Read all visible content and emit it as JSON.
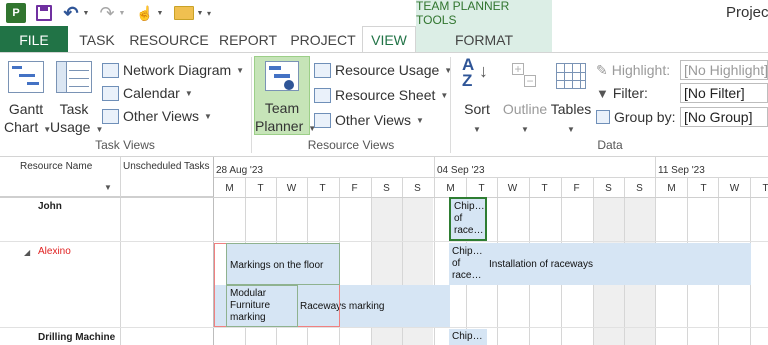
{
  "quick_access": {
    "app_icon_label": "P",
    "more_glyph": "▾"
  },
  "title_bar": {
    "tools_title": "TEAM PLANNER TOOLS",
    "app_title": "Project"
  },
  "tabs": [
    "FILE",
    "TASK",
    "RESOURCE",
    "REPORT",
    "PROJECT",
    "VIEW",
    "FORMAT"
  ],
  "active_tab": "VIEW",
  "ribbon": {
    "task_views": {
      "label": "Task Views",
      "gantt_line1": "Gantt",
      "gantt_line2": "Chart",
      "usage_line1": "Task",
      "usage_line2": "Usage",
      "network_diagram": "Network Diagram",
      "calendar": "Calendar",
      "other_views": "Other Views"
    },
    "resource_views": {
      "label": "Resource Views",
      "team_line1": "Team",
      "team_line2": "Planner",
      "resource_usage": "Resource Usage",
      "resource_sheet": "Resource Sheet",
      "other_views": "Other Views"
    },
    "data": {
      "label": "Data",
      "sort": "Sort",
      "outline": "Outline",
      "tables": "Tables",
      "highlight_label": "Highlight:",
      "highlight_value": "[No Highlight]",
      "filter_label": "Filter:",
      "filter_value": "[No Filter]",
      "group_label": "Group by:",
      "group_value": "[No Group]"
    }
  },
  "grid": {
    "columns": {
      "resource_name": "Resource Name",
      "unscheduled": "Unscheduled Tasks"
    },
    "weeks": [
      "28 Aug '23",
      "04 Sep '23",
      "11 Sep '23"
    ],
    "days": [
      "M",
      "T",
      "W",
      "T",
      "F",
      "S",
      "S",
      "M",
      "T",
      "W",
      "T",
      "F",
      "S",
      "S",
      "M",
      "T",
      "W",
      "T"
    ],
    "resources": [
      "John",
      "Alexino",
      "Drilling Machine"
    ],
    "tasks": {
      "chip_line1": "Chip…",
      "chip_line2": "of",
      "chip_line3": "race…",
      "markings_floor": "Markings on the floor",
      "installation": "Installation of raceways",
      "modular_line1": "Modular",
      "modular_line2": "Furniture",
      "modular_line3": "marking",
      "raceways_marking": "Raceways marking"
    }
  },
  "colors": {
    "file_tab": "#217346",
    "tools_band": "#dceee6",
    "task_bar": "#d6e5f4",
    "overallocated": "#e02020"
  }
}
